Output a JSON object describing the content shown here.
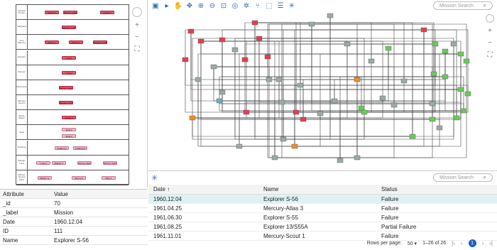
{
  "timeline": {
    "rows": [
      {
        "label": "Sputnik Korolev",
        "chips": [
          {
            "text": "Sputnik 1",
            "color": "red"
          },
          {
            "text": "Mercury-Atlas 3",
            "color": "red"
          },
          {
            "text": "Vostok 1",
            "color": "red"
          }
        ]
      },
      {
        "label": "Vanguard",
        "chips": [
          {
            "text": "Explorer S-56",
            "color": "red"
          }
        ]
      },
      {
        "label": "Juno Mercury",
        "chips": [
          {
            "text": "Ranger 1",
            "color": "red"
          },
          {
            "text": "Ranger 2",
            "color": "red"
          },
          {
            "text": "Explorer S-55",
            "color": "red"
          }
        ]
      },
      {
        "label": "Explorer",
        "chips": [
          {
            "text": "Luna 1",
            "color": "red"
          }
        ]
      },
      {
        "label": "Pioneer",
        "chips": [
          {
            "text": "Luna 2",
            "color": "red"
          }
        ]
      },
      {
        "label": "Discoverer",
        "chips": [
          {
            "text": "Mercury-Scout 1",
            "color": "red"
          }
        ]
      },
      {
        "label": "Mercury Gemini",
        "chips": [
          {
            "text": "Explorer 13/S55A",
            "color": "red"
          }
        ]
      },
      {
        "label": "Apollo Saturn",
        "chips": [
          {
            "text": "Vostok 3",
            "color": "red"
          }
        ]
      },
      {
        "label": "Vega",
        "chips": [
          {
            "text": "Vega 1",
            "color": "pink"
          },
          {
            "text": "Vega 2",
            "color": "pink"
          }
        ]
      },
      {
        "label": "Voskhod",
        "chips": [
          {
            "text": "Voskhod 1",
            "color": "pink"
          },
          {
            "text": "Voskhod 2",
            "color": "pink"
          }
        ]
      },
      {
        "label": "Ranger Luna",
        "chips": [
          {
            "text": "Luna 3",
            "color": "pink"
          },
          {
            "text": "Ranger 3",
            "color": "pink"
          },
          {
            "text": "Mercury-Redstone 1",
            "color": "pink"
          },
          {
            "text": "Mercury-Atlas 1",
            "color": "pink"
          }
        ]
      },
      {
        "label": "Mariner Venera Mars",
        "chips": [
          {
            "text": "Mariner 1",
            "color": "pink"
          },
          {
            "text": "Venera 1",
            "color": "pink"
          },
          {
            "text": "Mars 1",
            "color": "pink"
          }
        ]
      }
    ]
  },
  "graph_search": {
    "placeholder": "Mission Search"
  },
  "table_search": {
    "placeholder": "Mission Search"
  },
  "toolbar": {
    "icons": [
      "layout-icon",
      "pointer-icon",
      "hand-icon",
      "move-icon",
      "zoom-in-icon",
      "zoom-out-icon",
      "zoom-fit-icon",
      "target-icon",
      "snowflake-icon",
      "branch-icon",
      "marquee-icon",
      "list-icon",
      "sparkle-icon"
    ]
  },
  "attributes": {
    "headers": {
      "attribute": "Attribute",
      "value": "Value"
    },
    "rows": [
      {
        "key": "_id",
        "value": "70"
      },
      {
        "key": "_label",
        "value": "Mission"
      },
      {
        "key": "Date",
        "value": "1960.12.04"
      },
      {
        "key": "ID",
        "value": "111"
      },
      {
        "key": "Name",
        "value": "Explorer S-56"
      }
    ]
  },
  "table": {
    "columns": {
      "date": "Date",
      "sort": "↑",
      "name": "Name",
      "status": "Status"
    },
    "rows": [
      {
        "date": "1960.12.04",
        "name": "Explorer S-56",
        "status": "Failure"
      },
      {
        "date": "1961.04.25",
        "name": "Mercury-Atlas 3",
        "status": "Failure"
      },
      {
        "date": "1961.06.30",
        "name": "Explorer S-55",
        "status": "Failure"
      },
      {
        "date": "1961.08.25",
        "name": "Explorer 13/S55A",
        "status": "Partial Failure"
      },
      {
        "date": "1961.11.01",
        "name": "Mercury-Scout 1",
        "status": "Failure"
      }
    ],
    "pager": {
      "rows_label": "Rows per page:",
      "rows_value": "50",
      "range": "1–26 of 26",
      "page": "1"
    }
  },
  "colors": {
    "accent": "#1e5fc4",
    "selected": "#dff1f5",
    "node_red": "#e04050",
    "node_green": "#66cc55",
    "node_orange": "#f08c2a"
  }
}
